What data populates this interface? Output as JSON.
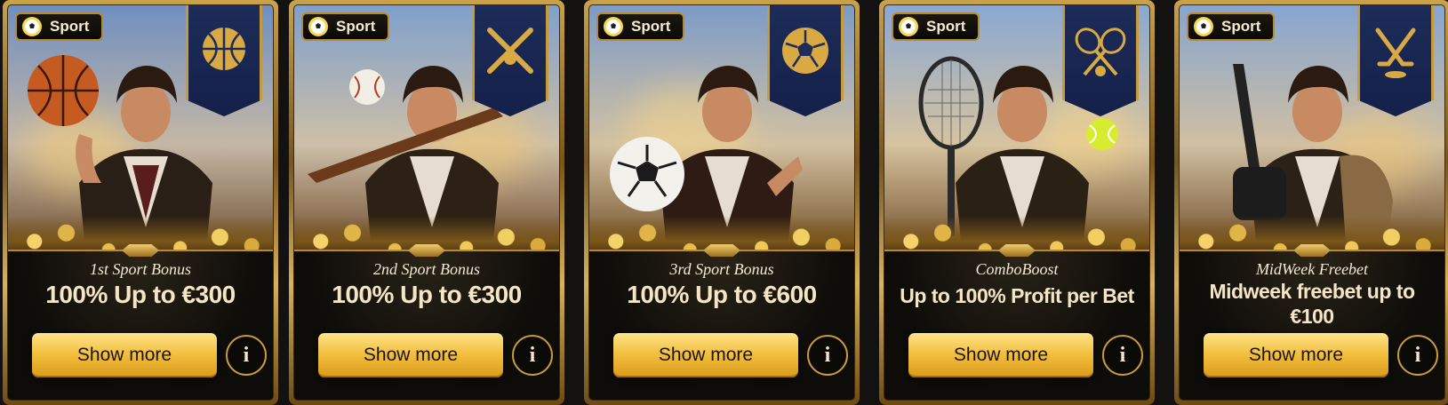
{
  "cards": [
    {
      "category": "Sport",
      "category_icon": "soccer-ball-icon",
      "banner_icon": "basketball-icon",
      "held_item": "basketball",
      "subtitle": "1st Sport Bonus",
      "title": "100% Up to €300",
      "button": "Show more",
      "info": "i"
    },
    {
      "category": "Sport",
      "category_icon": "soccer-ball-icon",
      "banner_icon": "crossed-baseball-bats-icon",
      "held_item": "baseball-bat",
      "subtitle": "2nd Sport Bonus",
      "title": "100% Up to €300",
      "button": "Show more",
      "info": "i"
    },
    {
      "category": "Sport",
      "category_icon": "soccer-ball-icon",
      "banner_icon": "soccer-ball-icon",
      "held_item": "soccer-ball",
      "subtitle": "3rd Sport Bonus",
      "title": "100% Up to €600",
      "button": "Show more",
      "info": "i"
    },
    {
      "category": "Sport",
      "category_icon": "soccer-ball-icon",
      "banner_icon": "crossed-tennis-rackets-icon",
      "held_item": "tennis-racket",
      "subtitle": "ComboBoost",
      "title": "Up to 100% Profit per Bet",
      "button": "Show more",
      "info": "i"
    },
    {
      "category": "Sport",
      "category_icon": "soccer-ball-icon",
      "banner_icon": "crossed-hockey-sticks-icon",
      "held_item": "hockey-stick",
      "subtitle": "MidWeek Freebet",
      "title": "Midweek freebet up to €100",
      "button": "Show more",
      "info": "i"
    }
  ],
  "colors": {
    "gold": "#c89a3e",
    "button_gold": "#f1bd3a",
    "banner_blue": "#1d2c58",
    "panel_dark": "#0e0c09"
  }
}
